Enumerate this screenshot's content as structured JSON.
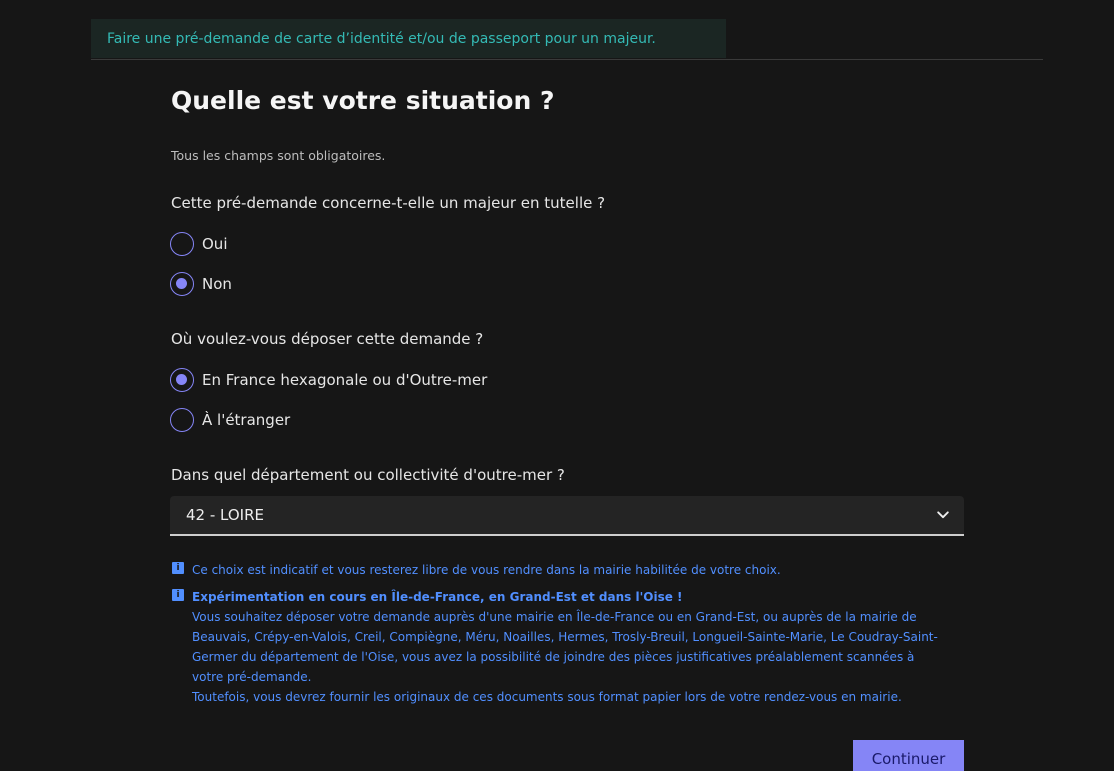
{
  "banner": {
    "text": "Faire une pré-demande de carte d’identité et/ou de passeport pour un majeur."
  },
  "form": {
    "title": "Quelle est votre situation ?",
    "required_hint": "Tous les champs sont obligatoires.",
    "q_tutelle": {
      "legend": "Cette pré-demande concerne-t-elle un majeur en tutelle ?",
      "options": [
        {
          "label": "Oui",
          "checked": false
        },
        {
          "label": "Non",
          "checked": true
        }
      ]
    },
    "q_depot": {
      "legend": "Où voulez-vous déposer cette demande ?",
      "options": [
        {
          "label": "En France hexagonale ou d'Outre-mer",
          "checked": true
        },
        {
          "label": "À l'étranger",
          "checked": false
        }
      ]
    },
    "q_departement": {
      "legend": "Dans quel département ou collectivité d'outre-mer ?",
      "selected": "42 - LOIRE"
    },
    "notice_choice": "Ce choix est indicatif et vous resterez libre de vous rendre dans la mairie habilitée de votre choix.",
    "notice_experiment": {
      "title": "Expérimentation en cours en Île-de-France, en Grand-Est et dans l'Oise !",
      "lines": [
        "Vous souhaitez déposer votre demande auprès d'une mairie en Île-de-France ou en Grand-Est, ou auprès de la mairie de",
        "Beauvais, Crépy-en-Valois, Creil, Compiègne, Méru, Noailles, Hermes, Trosly-Breuil, Longueil-Sainte-Marie, Le Coudray-Saint-",
        "Germer du département de l'Oise, vous avez la possibilité de joindre des pièces justificatives préalablement scannées à",
        "votre pré-demande.",
        "Toutefois, vous devrez fournir les originaux de ces documents sous format papier lors de votre rendez-vous en mairie."
      ]
    },
    "continue_label": "Continuer"
  },
  "icons": {
    "info": "info-icon",
    "chevron": "chevron-down-icon"
  },
  "colors": {
    "background": "#161616",
    "accent": "#8585f6",
    "info_blue": "#518fff",
    "banner_bg": "#1b2623",
    "banner_text": "#34bab5"
  }
}
